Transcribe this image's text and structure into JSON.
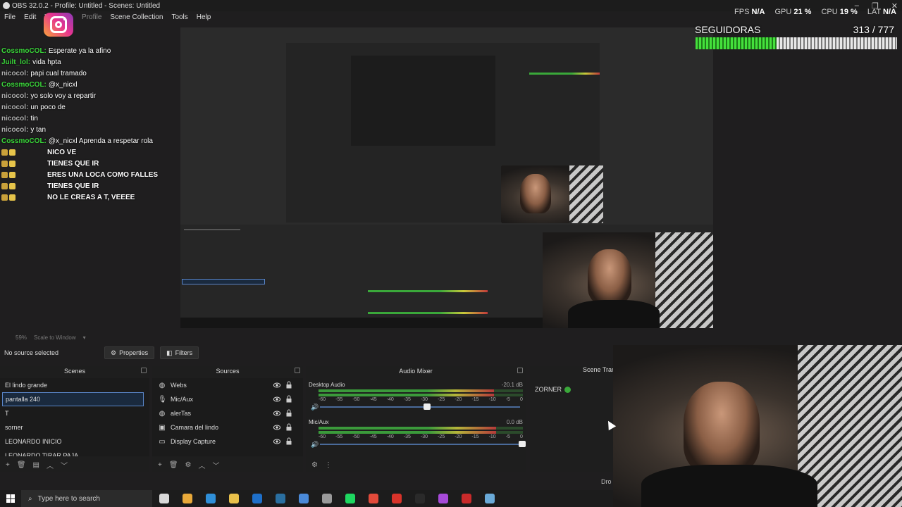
{
  "window": {
    "title": "OBS 32.0.2 - Profile: Untitled - Scenes: Untitled"
  },
  "menu": [
    "File",
    "Edit",
    "V",
    "Profile",
    "Scene Collection",
    "Tools",
    "Help"
  ],
  "stats": {
    "fps_label": "FPS",
    "fps_value": "N/A",
    "gpu_label": "GPU",
    "gpu_value": "21 %",
    "cpu_label": "CPU",
    "cpu_value": "19 %",
    "lat_label": "LAT",
    "lat_value": "N/A"
  },
  "goal": {
    "label": "SEGUIDORAS",
    "count": "313 / 777",
    "current": 313,
    "target": 777
  },
  "chat": [
    {
      "user": "CossmoCOL:",
      "msg": "Esperate ya la afino",
      "color": "#3ad63a",
      "badges": 0,
      "alert": false
    },
    {
      "user": "Juilt_lol:",
      "msg": "vida hpta",
      "color": "#3ad63a",
      "badges": 0,
      "alert": false
    },
    {
      "user": "nicocol:",
      "msg": "papi cual tramado",
      "color": "#b0b0b0",
      "badges": 0,
      "alert": false
    },
    {
      "user": "CossmoCOL:",
      "msg": "@x_nicxl",
      "color": "#3ad63a",
      "badges": 0,
      "alert": false
    },
    {
      "user": "nicocol:",
      "msg": "yo solo voy a repartir",
      "color": "#b0b0b0",
      "badges": 0,
      "alert": false
    },
    {
      "user": "nicocol:",
      "msg": "un poco de",
      "color": "#b0b0b0",
      "badges": 0,
      "alert": false
    },
    {
      "user": "nicocol:",
      "msg": "tin",
      "color": "#b0b0b0",
      "badges": 0,
      "alert": false
    },
    {
      "user": "nicocol:",
      "msg": "y tan",
      "color": "#b0b0b0",
      "badges": 0,
      "alert": false
    },
    {
      "user": "CossmoCOL:",
      "msg": "@x_nicxl Aprenda a respetar rola",
      "color": "#3ad63a",
      "badges": 0,
      "alert": false
    },
    {
      "user": "",
      "msg": "NICO VE",
      "color": "#d03030",
      "badges": 2,
      "alert": true
    },
    {
      "user": "",
      "msg": "TIENES QUE IR",
      "color": "#d03030",
      "badges": 2,
      "alert": true
    },
    {
      "user": "",
      "msg": "ERES UNA LOCA COMO FALLES",
      "color": "#d03030",
      "badges": 2,
      "alert": true
    },
    {
      "user": "",
      "msg": "TIENES QUE IR",
      "color": "#d03030",
      "badges": 2,
      "alert": true
    },
    {
      "user": "",
      "msg": "NO LE CREAS A T, VEEEE",
      "color": "#d03030",
      "badges": 2,
      "alert": true
    }
  ],
  "scale": {
    "zoom": "59%",
    "mode": "Scale to Window"
  },
  "toolbar": {
    "no_source": "No source selected",
    "properties": "Properties",
    "filters": "Filters"
  },
  "scenes": {
    "title": "Scenes",
    "items": [
      "El lindo grande",
      "pantalla 240",
      "T",
      "sorner",
      "LEONARDO INICIO",
      "LEONARDO TIRAR PAJA"
    ],
    "selected": 1
  },
  "sources": {
    "title": "Sources",
    "items": [
      {
        "name": "Webs",
        "icon": "globe-icon",
        "glyph": "◍"
      },
      {
        "name": "Mic/Aux",
        "icon": "microphone-icon",
        "glyph": "🎙"
      },
      {
        "name": "alerTas",
        "icon": "globe-icon",
        "glyph": "◍"
      },
      {
        "name": "Camara del lindo",
        "icon": "camera-icon",
        "glyph": "▣"
      },
      {
        "name": "Display Capture",
        "icon": "monitor-icon",
        "glyph": "▭"
      }
    ]
  },
  "mixer": {
    "title": "Audio Mixer",
    "ticks": [
      "-60",
      "-55",
      "-50",
      "-45",
      "-40",
      "-35",
      "-30",
      "-25",
      "-20",
      "-15",
      "-10",
      "-5",
      "0"
    ],
    "channels": [
      {
        "name": "Desktop Audio",
        "db": "-20.1 dB",
        "level": 0.86,
        "volume": 0.52
      },
      {
        "name": "Mic/Aux",
        "db": "0.0 dB",
        "level": 0.87,
        "volume": 1.0
      }
    ]
  },
  "transitions": {
    "title": "Scene Tran",
    "active": "ZORNER",
    "footer": "Dro"
  },
  "taskbar": {
    "search_placeholder": "Type here to search",
    "apps": [
      {
        "name": "task-view-icon",
        "color": "#d8d8d8"
      },
      {
        "name": "chrome-canary-icon",
        "color": "#e8a93a"
      },
      {
        "name": "edge-icon",
        "color": "#2f8fd8"
      },
      {
        "name": "file-explorer-icon",
        "color": "#e8c04a"
      },
      {
        "name": "outlook-icon",
        "color": "#1e6fc8"
      },
      {
        "name": "steam-icon",
        "color": "#2a6fa0"
      },
      {
        "name": "calculator-icon",
        "color": "#4a8ad8"
      },
      {
        "name": "app-icon",
        "color": "#9a9a9a"
      },
      {
        "name": "spotify-icon",
        "color": "#1ed760"
      },
      {
        "name": "chrome-icon",
        "color": "#e24a3a"
      },
      {
        "name": "opera-icon",
        "color": "#d8332a"
      },
      {
        "name": "obs-icon",
        "color": "#2a2a2a"
      },
      {
        "name": "messenger-icon",
        "color": "#a64ad8"
      },
      {
        "name": "red-app-icon",
        "color": "#c82a2a"
      },
      {
        "name": "notepad-icon",
        "color": "#6aaad8"
      }
    ]
  }
}
